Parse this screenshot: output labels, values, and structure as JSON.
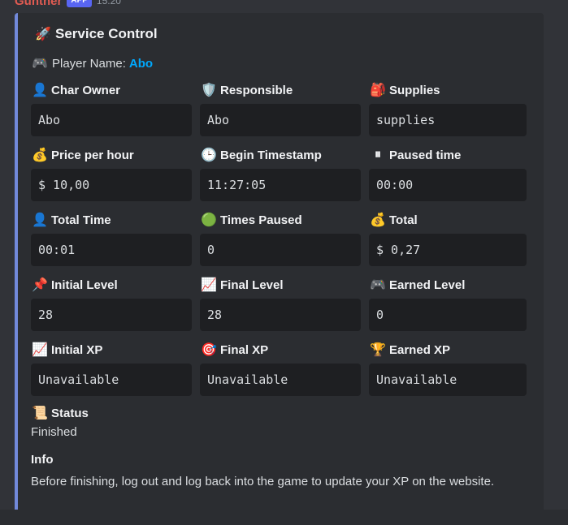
{
  "message": {
    "author": "Gunther",
    "badge": "APP",
    "time": "15:20"
  },
  "embed": {
    "accent_color": "#7289da",
    "title_icon": "🚀",
    "title": "Service Control",
    "player_icon": "🎮",
    "player_label": "Player Name:",
    "player_name": "Abo",
    "fields": [
      {
        "icon": "👤",
        "name": "Char Owner",
        "value": "Abo"
      },
      {
        "icon": "🛡️",
        "name": "Responsible",
        "value": "Abo"
      },
      {
        "icon": "🎒",
        "name": "Supplies",
        "value": "supplies"
      },
      {
        "icon": "💰",
        "name": "Price per hour",
        "value": "$ 10,00"
      },
      {
        "icon": "🕒",
        "name": "Begin Timestamp",
        "value": "11:27:05"
      },
      {
        "icon": "⏸",
        "name": "Paused time",
        "value": "00:00"
      },
      {
        "icon": "👤",
        "name": "Total Time",
        "value": "00:01"
      },
      {
        "icon": "🟢",
        "name": "Times Paused",
        "value": "0"
      },
      {
        "icon": "💰",
        "name": "Total",
        "value": "$ 0,27"
      },
      {
        "icon": "📌",
        "name": "Initial Level",
        "value": "28"
      },
      {
        "icon": "📈",
        "name": "Final Level",
        "value": "28"
      },
      {
        "icon": "🎮",
        "name": "Earned Level",
        "value": "0"
      },
      {
        "icon": "📈",
        "name": "Initial XP",
        "value": "Unavailable"
      },
      {
        "icon": "🎯",
        "name": "Final XP",
        "value": "Unavailable"
      },
      {
        "icon": "🏆",
        "name": "Earned XP",
        "value": "Unavailable"
      }
    ],
    "status": {
      "icon": "📜",
      "name": "Status",
      "value": "Finished"
    },
    "info": {
      "name": "Info",
      "value": "Before finishing, log out and log back into the game to update your XP on the website."
    }
  }
}
